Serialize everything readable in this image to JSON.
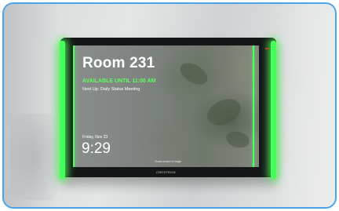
{
  "panel": {
    "room_name": "Room 231",
    "status": "AVAILABLE UNTIL 11:00 AM",
    "next_up": "Next Up: Daily Status Meeting",
    "date": "Friday, Nov 23",
    "time": "9:29",
    "touch_hint": "Touch screen to begin",
    "brand": "CRESTRON"
  },
  "colors": {
    "frame_border": "#4aa3e8",
    "status_led": "#45ff5a",
    "status_text": "#5dff63"
  }
}
